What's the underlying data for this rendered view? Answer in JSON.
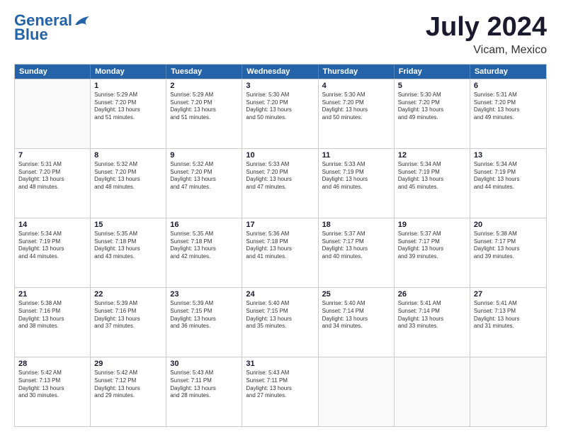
{
  "header": {
    "logo_line1": "General",
    "logo_line2": "Blue",
    "title": "July 2024",
    "subtitle": "Vicam, Mexico"
  },
  "days": [
    "Sunday",
    "Monday",
    "Tuesday",
    "Wednesday",
    "Thursday",
    "Friday",
    "Saturday"
  ],
  "rows": [
    [
      {
        "day": "",
        "lines": []
      },
      {
        "day": "1",
        "lines": [
          "Sunrise: 5:29 AM",
          "Sunset: 7:20 PM",
          "Daylight: 13 hours",
          "and 51 minutes."
        ]
      },
      {
        "day": "2",
        "lines": [
          "Sunrise: 5:29 AM",
          "Sunset: 7:20 PM",
          "Daylight: 13 hours",
          "and 51 minutes."
        ]
      },
      {
        "day": "3",
        "lines": [
          "Sunrise: 5:30 AM",
          "Sunset: 7:20 PM",
          "Daylight: 13 hours",
          "and 50 minutes."
        ]
      },
      {
        "day": "4",
        "lines": [
          "Sunrise: 5:30 AM",
          "Sunset: 7:20 PM",
          "Daylight: 13 hours",
          "and 50 minutes."
        ]
      },
      {
        "day": "5",
        "lines": [
          "Sunrise: 5:30 AM",
          "Sunset: 7:20 PM",
          "Daylight: 13 hours",
          "and 49 minutes."
        ]
      },
      {
        "day": "6",
        "lines": [
          "Sunrise: 5:31 AM",
          "Sunset: 7:20 PM",
          "Daylight: 13 hours",
          "and 49 minutes."
        ]
      }
    ],
    [
      {
        "day": "7",
        "lines": [
          "Sunrise: 5:31 AM",
          "Sunset: 7:20 PM",
          "Daylight: 13 hours",
          "and 48 minutes."
        ]
      },
      {
        "day": "8",
        "lines": [
          "Sunrise: 5:32 AM",
          "Sunset: 7:20 PM",
          "Daylight: 13 hours",
          "and 48 minutes."
        ]
      },
      {
        "day": "9",
        "lines": [
          "Sunrise: 5:32 AM",
          "Sunset: 7:20 PM",
          "Daylight: 13 hours",
          "and 47 minutes."
        ]
      },
      {
        "day": "10",
        "lines": [
          "Sunrise: 5:33 AM",
          "Sunset: 7:20 PM",
          "Daylight: 13 hours",
          "and 47 minutes."
        ]
      },
      {
        "day": "11",
        "lines": [
          "Sunrise: 5:33 AM",
          "Sunset: 7:19 PM",
          "Daylight: 13 hours",
          "and 46 minutes."
        ]
      },
      {
        "day": "12",
        "lines": [
          "Sunrise: 5:34 AM",
          "Sunset: 7:19 PM",
          "Daylight: 13 hours",
          "and 45 minutes."
        ]
      },
      {
        "day": "13",
        "lines": [
          "Sunrise: 5:34 AM",
          "Sunset: 7:19 PM",
          "Daylight: 13 hours",
          "and 44 minutes."
        ]
      }
    ],
    [
      {
        "day": "14",
        "lines": [
          "Sunrise: 5:34 AM",
          "Sunset: 7:19 PM",
          "Daylight: 13 hours",
          "and 44 minutes."
        ]
      },
      {
        "day": "15",
        "lines": [
          "Sunrise: 5:35 AM",
          "Sunset: 7:18 PM",
          "Daylight: 13 hours",
          "and 43 minutes."
        ]
      },
      {
        "day": "16",
        "lines": [
          "Sunrise: 5:35 AM",
          "Sunset: 7:18 PM",
          "Daylight: 13 hours",
          "and 42 minutes."
        ]
      },
      {
        "day": "17",
        "lines": [
          "Sunrise: 5:36 AM",
          "Sunset: 7:18 PM",
          "Daylight: 13 hours",
          "and 41 minutes."
        ]
      },
      {
        "day": "18",
        "lines": [
          "Sunrise: 5:37 AM",
          "Sunset: 7:17 PM",
          "Daylight: 13 hours",
          "and 40 minutes."
        ]
      },
      {
        "day": "19",
        "lines": [
          "Sunrise: 5:37 AM",
          "Sunset: 7:17 PM",
          "Daylight: 13 hours",
          "and 39 minutes."
        ]
      },
      {
        "day": "20",
        "lines": [
          "Sunrise: 5:38 AM",
          "Sunset: 7:17 PM",
          "Daylight: 13 hours",
          "and 39 minutes."
        ]
      }
    ],
    [
      {
        "day": "21",
        "lines": [
          "Sunrise: 5:38 AM",
          "Sunset: 7:16 PM",
          "Daylight: 13 hours",
          "and 38 minutes."
        ]
      },
      {
        "day": "22",
        "lines": [
          "Sunrise: 5:39 AM",
          "Sunset: 7:16 PM",
          "Daylight: 13 hours",
          "and 37 minutes."
        ]
      },
      {
        "day": "23",
        "lines": [
          "Sunrise: 5:39 AM",
          "Sunset: 7:15 PM",
          "Daylight: 13 hours",
          "and 36 minutes."
        ]
      },
      {
        "day": "24",
        "lines": [
          "Sunrise: 5:40 AM",
          "Sunset: 7:15 PM",
          "Daylight: 13 hours",
          "and 35 minutes."
        ]
      },
      {
        "day": "25",
        "lines": [
          "Sunrise: 5:40 AM",
          "Sunset: 7:14 PM",
          "Daylight: 13 hours",
          "and 34 minutes."
        ]
      },
      {
        "day": "26",
        "lines": [
          "Sunrise: 5:41 AM",
          "Sunset: 7:14 PM",
          "Daylight: 13 hours",
          "and 33 minutes."
        ]
      },
      {
        "day": "27",
        "lines": [
          "Sunrise: 5:41 AM",
          "Sunset: 7:13 PM",
          "Daylight: 13 hours",
          "and 31 minutes."
        ]
      }
    ],
    [
      {
        "day": "28",
        "lines": [
          "Sunrise: 5:42 AM",
          "Sunset: 7:13 PM",
          "Daylight: 13 hours",
          "and 30 minutes."
        ]
      },
      {
        "day": "29",
        "lines": [
          "Sunrise: 5:42 AM",
          "Sunset: 7:12 PM",
          "Daylight: 13 hours",
          "and 29 minutes."
        ]
      },
      {
        "day": "30",
        "lines": [
          "Sunrise: 5:43 AM",
          "Sunset: 7:11 PM",
          "Daylight: 13 hours",
          "and 28 minutes."
        ]
      },
      {
        "day": "31",
        "lines": [
          "Sunrise: 5:43 AM",
          "Sunset: 7:11 PM",
          "Daylight: 13 hours",
          "and 27 minutes."
        ]
      },
      {
        "day": "",
        "lines": []
      },
      {
        "day": "",
        "lines": []
      },
      {
        "day": "",
        "lines": []
      }
    ]
  ]
}
